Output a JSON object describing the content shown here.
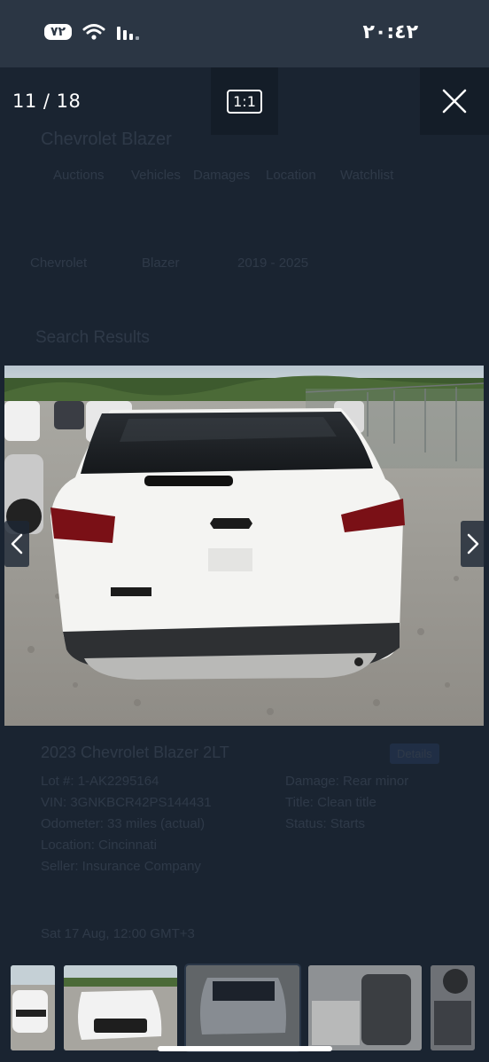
{
  "status_bar": {
    "time": "٢٠:٤٢",
    "battery": "٧٢"
  },
  "viewer": {
    "counter": "11 / 18",
    "zoom_label": "1:1"
  },
  "background_page": {
    "title": "Chevrolet Blazer",
    "tabs": [
      "Auctions",
      "Vehicles",
      "Damages",
      "Location",
      "Watchlist"
    ],
    "filters": [
      "Chevrolet",
      "Blazer",
      "2019 - 2025"
    ],
    "section": "Search Results",
    "listing_title": "2023 Chevrolet Blazer 2LT",
    "badge": "Details",
    "details_left": [
      "Lot #: 1-AK2295164",
      "VIN: 3GNKBCR42PS144431",
      "Odometer: 33 miles (actual)",
      "Location: Cincinnati",
      "Seller: Insurance Company"
    ],
    "details_right": [
      "Damage: Rear minor",
      "Title: Clean title",
      "Status: Starts"
    ],
    "footer_note": "Sat 17 Aug, 12:00 GMT+3"
  }
}
